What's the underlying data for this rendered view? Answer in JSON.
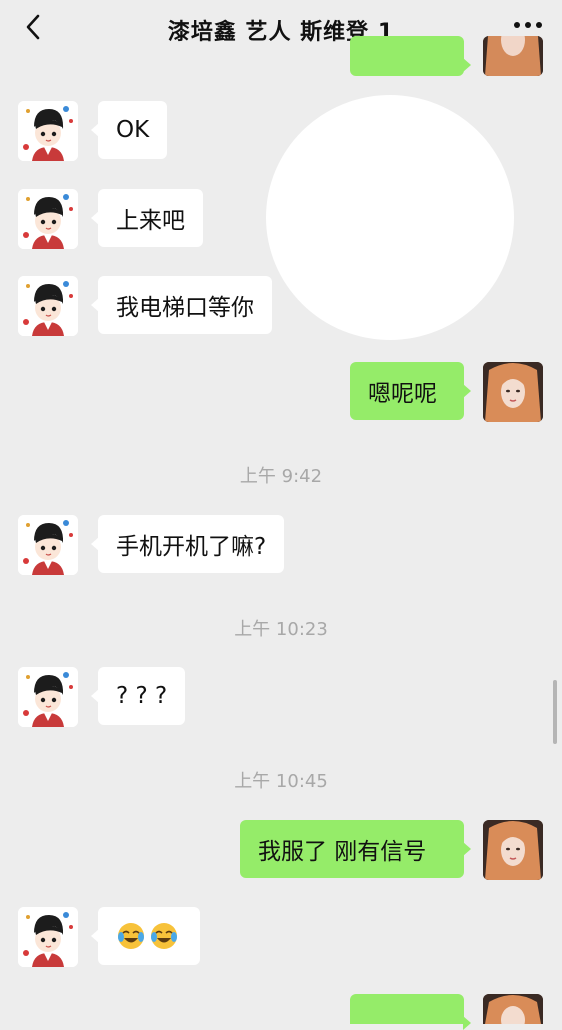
{
  "header": {
    "title": "漆培鑫 艺人 斯维登 1",
    "back_icon": "chevron-left-icon",
    "more_icon": "ellipsis-icon"
  },
  "messages": [
    {
      "side": "left",
      "text": "OK"
    },
    {
      "side": "left",
      "text": "上来吧"
    },
    {
      "side": "left",
      "text": "我电梯口等你"
    },
    {
      "side": "right",
      "text": "嗯呢呢"
    },
    {
      "side": "left",
      "text": "手机开机了嘛?"
    },
    {
      "side": "left",
      "text": "? ? ?"
    },
    {
      "side": "right",
      "text": "我服了 刚有信号"
    },
    {
      "side": "left",
      "emoji": [
        "crying-laughing-emoji",
        "crying-laughing-emoji"
      ]
    }
  ],
  "timestamps": [
    "上午 9:42",
    "上午 10:23",
    "上午 10:45"
  ],
  "colors": {
    "background": "#ededed",
    "incoming_bubble": "#ffffff",
    "outgoing_bubble": "#95ec69"
  }
}
